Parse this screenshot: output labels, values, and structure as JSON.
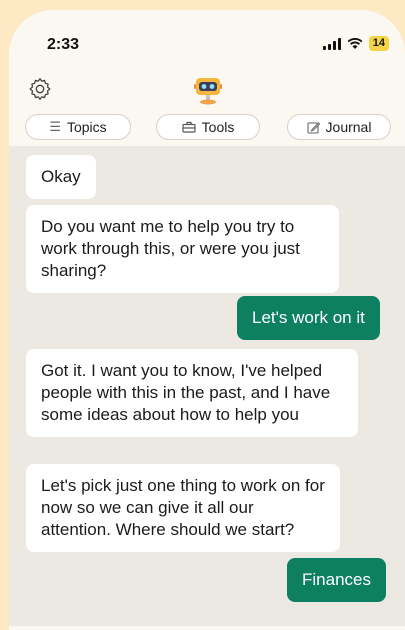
{
  "status": {
    "time": "2:33",
    "battery": "14"
  },
  "tabs": [
    {
      "label": "Topics",
      "icon": "list-icon"
    },
    {
      "label": "Tools",
      "icon": "toolbox-icon"
    },
    {
      "label": "Journal",
      "icon": "journal-icon"
    }
  ],
  "messages": [
    {
      "from": "bot",
      "text": "Okay"
    },
    {
      "from": "bot",
      "text": "Do you want me to help you try to work through this, or were you just sharing?"
    },
    {
      "from": "user",
      "text": "Let's work on it"
    },
    {
      "from": "bot",
      "text": "Got it. I want you to know, I've helped people with this in the past, and I have some ideas about how to help you"
    },
    {
      "from": "bot",
      "text": "Let's pick just one thing to work on for now so we can give it all our attention. Where should we start?"
    },
    {
      "from": "user",
      "text": "Finances"
    }
  ],
  "colors": {
    "user_bubble": "#0e8062",
    "background": "#fde9c4",
    "chat_bg": "#ece9e2"
  }
}
